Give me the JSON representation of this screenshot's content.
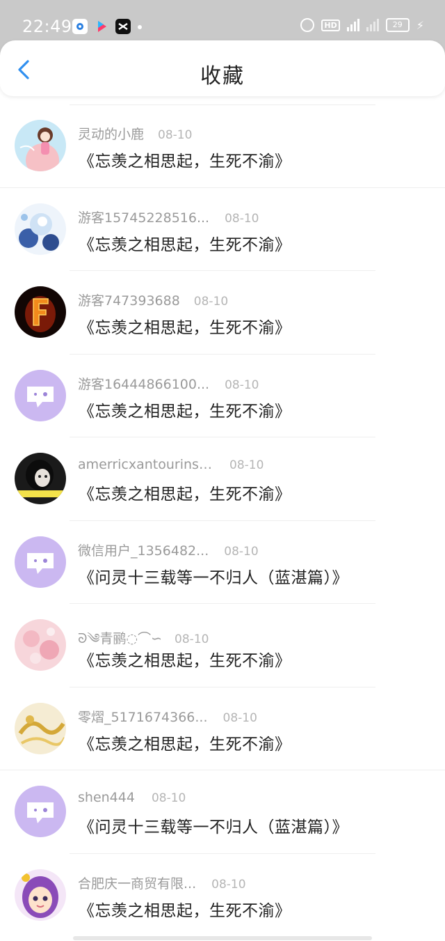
{
  "status_bar": {
    "time": "22:49",
    "battery": "29"
  },
  "header": {
    "title": "收藏"
  },
  "colors": {
    "accent": "#2f8ff0",
    "default_avatar": "#c9b5f0"
  },
  "items": [
    {
      "username": "灵动的小鹿",
      "date": "08-10",
      "title": "《忘羡之相思起，生死不渝》",
      "avatar": "anime-girl-avatar"
    },
    {
      "username": "游客15745228516...",
      "date": "08-10",
      "title": "《忘羡之相思起，生死不渝》",
      "avatar": "blue-flower-avatar"
    },
    {
      "username": "游客747393688",
      "date": "08-10",
      "title": "《忘羡之相思起，生死不渝》",
      "avatar": "fire-letter-avatar"
    },
    {
      "username": "游客16444866100...",
      "date": "08-10",
      "title": "《忘羡之相思起，生死不渝》",
      "avatar": "default-chat-avatar"
    },
    {
      "username": "amerricxantourinster",
      "date": "08-10",
      "title": "《忘羡之相思起，生死不渝》",
      "avatar": "photo-avatar"
    },
    {
      "username": "微信用户_1356482...",
      "date": "08-10",
      "title": "《问灵十三载等一不归人（蓝湛篇）》",
      "avatar": "default-chat-avatar"
    },
    {
      "username": "青鹂",
      "date": "08-10",
      "title": "《忘羡之相思起，生死不渝》",
      "avatar": "pink-flower-avatar"
    },
    {
      "username": "零熠_5171674366...",
      "date": "08-10",
      "title": "《忘羡之相思起，生死不渝》",
      "avatar": "gold-dragon-avatar"
    },
    {
      "username": "shen444",
      "date": "08-10",
      "title": "《问灵十三载等一不归人（蓝湛篇）》",
      "avatar": "default-chat-avatar"
    },
    {
      "username": "合肥庆一商贸有限...",
      "date": "08-10",
      "title": "《忘羡之相思起，生死不渝》",
      "avatar": "cartoon-girl-avatar"
    }
  ]
}
